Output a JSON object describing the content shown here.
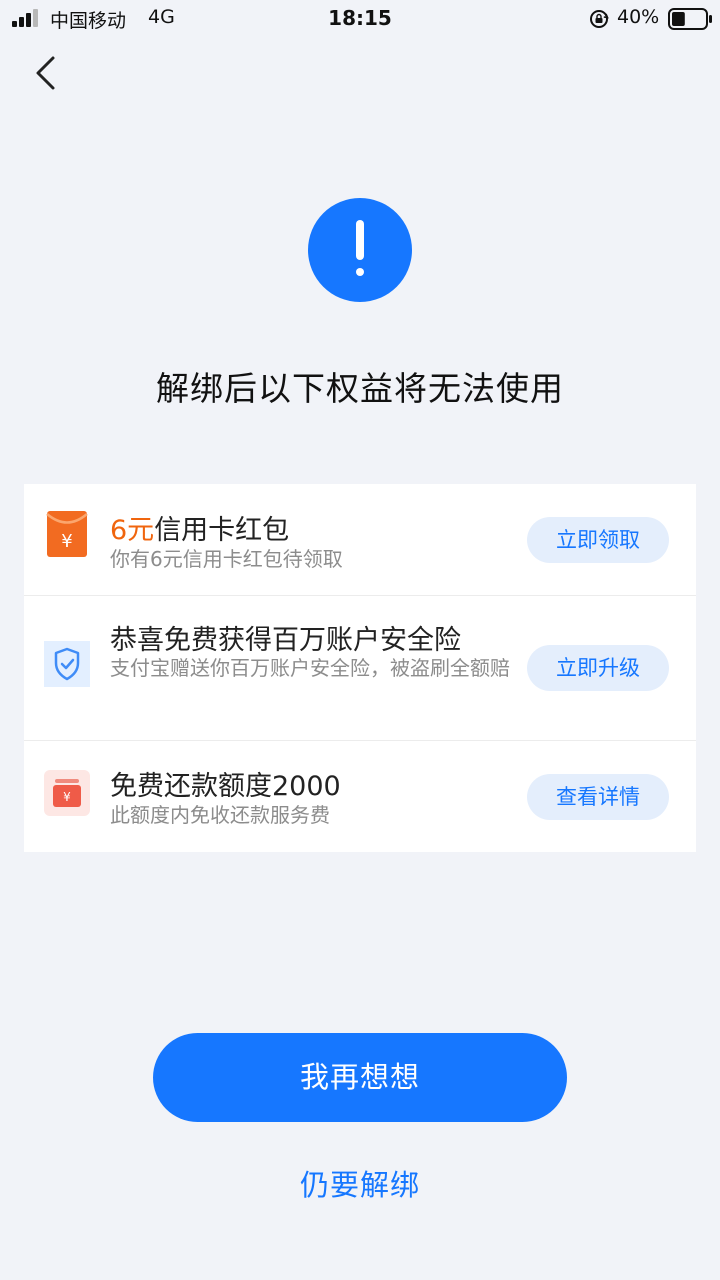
{
  "status_bar": {
    "carrier": "中国移动",
    "network": "4G",
    "time": "18:15",
    "battery": "40%",
    "battery_level": 0.4
  },
  "page": {
    "headline": "解绑后以下权益将无法使用"
  },
  "benefits": [
    {
      "icon": "red-envelope-icon",
      "title_accent": "6元",
      "title_rest": "信用卡红包",
      "description": "你有6元信用卡红包待领取",
      "action": "立即领取"
    },
    {
      "icon": "shield-check-icon",
      "title": "恭喜免费获得百万账户安全险",
      "description": "支付宝赠送你百万账户安全险，被盗刷全额赔",
      "action": "立即升级"
    },
    {
      "icon": "yuan-card-icon",
      "title": "免费还款额度2000",
      "description": "此额度内免收还款服务费",
      "action": "查看详情"
    }
  ],
  "actions": {
    "primary": "我再想想",
    "secondary": "仍要解绑"
  },
  "colors": {
    "primary": "#1677ff",
    "accent": "#f0650e",
    "background": "#f1f3f8"
  }
}
